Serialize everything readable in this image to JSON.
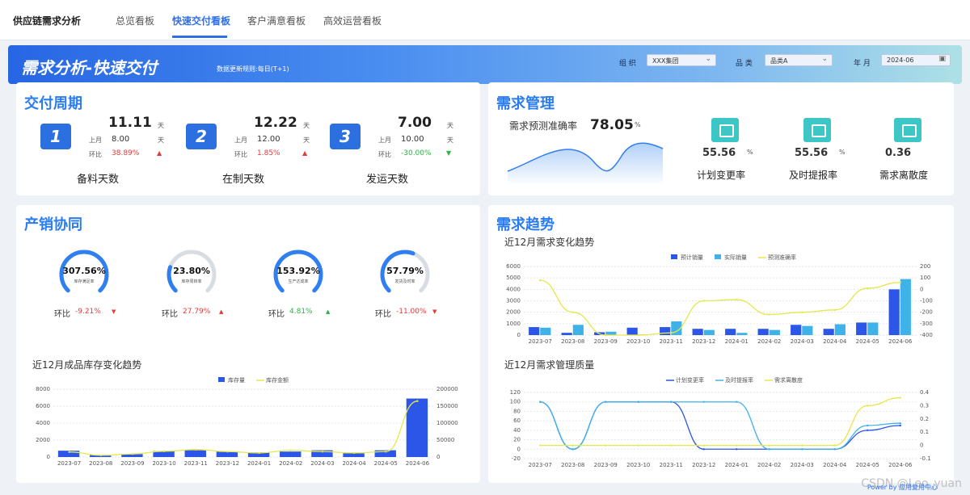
{
  "app": {
    "title": "供应链需求分析",
    "tabs": [
      "总览看板",
      "快速交付看板",
      "客户满意看板",
      "高效运营看板"
    ],
    "active_tab": 1
  },
  "banner": {
    "title": "需求分析-快速交付",
    "subtitle": "数据更新规则:每日(T+1)",
    "filters": [
      {
        "label": "组 织",
        "value": "XXX集团"
      },
      {
        "label": "品 类",
        "value": "品类A"
      },
      {
        "label": "年 月",
        "value": "2024-06"
      }
    ]
  },
  "delivery": {
    "title": "交付周期",
    "items": [
      {
        "num": "1",
        "value": "11.11",
        "unit": "天",
        "prev_label": "上月",
        "prev": "8.00",
        "prev_unit": "天",
        "chg_label": "环比",
        "chg": "38.89%",
        "dir": "up",
        "name": "备料天数"
      },
      {
        "num": "2",
        "value": "12.22",
        "unit": "天",
        "prev_label": "上月",
        "prev": "12.00",
        "prev_unit": "天",
        "chg_label": "环比",
        "chg": "1.85%",
        "dir": "up",
        "name": "在制天数"
      },
      {
        "num": "3",
        "value": "7.00",
        "unit": "天",
        "prev_label": "上月",
        "prev": "10.00",
        "prev_unit": "天",
        "chg_label": "环比",
        "chg": "-30.00%",
        "dir": "down",
        "name": "发运天数"
      }
    ]
  },
  "demand_mgmt": {
    "title": "需求管理",
    "acc_label": "需求预测准确率",
    "acc_value": "78.05",
    "acc_unit": "%",
    "metrics": [
      {
        "value": "55.56",
        "unit": "%",
        "name": "计划变更率",
        "icon": "document-icon"
      },
      {
        "value": "55.56",
        "unit": "%",
        "name": "及时提报率",
        "icon": "upload-icon"
      },
      {
        "value": "0.36",
        "unit": "",
        "name": "需求离散度",
        "icon": "scatter-icon"
      }
    ]
  },
  "prod_sales": {
    "title": "产销协同",
    "gauges": [
      {
        "value": "307.56%",
        "label": "库存满足率",
        "pct": 1.0,
        "color": "#2f7ff0",
        "chg_label": "环比",
        "chg": "-9.21%",
        "dir": "down"
      },
      {
        "value": "23.80%",
        "label": "库存周转率",
        "pct": 0.238,
        "color": "#2f7ff0",
        "chg_label": "环比",
        "chg": "27.79%",
        "dir": "up"
      },
      {
        "value": "153.92%",
        "label": "生产达成率",
        "pct": 1.0,
        "color": "#2f7ff0",
        "chg_label": "环比",
        "chg": "4.81%",
        "dir": "up"
      },
      {
        "value": "57.79%",
        "label": "发货及时率",
        "pct": 0.578,
        "color": "#2f7ff0",
        "chg_label": "环比",
        "chg": "-11.00%",
        "dir": "down"
      }
    ]
  },
  "trend": {
    "title": "需求趋势"
  },
  "colors": {
    "accent": "#2f6fe8",
    "bar1": "#2b56e8",
    "bar2": "#3fb2ea",
    "line_y": "#e4e84a"
  },
  "chart_data": [
    {
      "id": "inventory",
      "type": "bar",
      "title": "近12月成品库存变化趋势",
      "categories": [
        "2023-07",
        "2023-08",
        "2023-09",
        "2023-10",
        "2023-11",
        "2023-12",
        "2024-01",
        "2024-02",
        "2024-03",
        "2024-04",
        "2024-05",
        "2024-06"
      ],
      "series": [
        {
          "name": "库存量",
          "values": [
            750,
            250,
            350,
            700,
            800,
            650,
            550,
            650,
            800,
            450,
            800,
            6900
          ]
        },
        {
          "name": "库存金额",
          "values": [
            15000,
            5000,
            9000,
            17000,
            22000,
            16000,
            12000,
            20000,
            16000,
            12000,
            16000,
            165000
          ]
        }
      ],
      "ylim": [
        0,
        8000
      ],
      "y2lim": [
        0,
        200000
      ],
      "yticks": [
        0,
        2000,
        4000,
        6000,
        8000
      ],
      "y2ticks": [
        0,
        50000,
        100000,
        150000,
        200000
      ]
    },
    {
      "id": "demand_trend",
      "type": "bar",
      "title": "近12月需求变化趋势",
      "categories": [
        "2023-07",
        "2023-08",
        "2023-09",
        "2023-10",
        "2023-11",
        "2023-12",
        "2024-01",
        "2024-02",
        "2024-03",
        "2024-04",
        "2024-05",
        "2024-06"
      ],
      "series": [
        {
          "name": "预计销量",
          "values": [
            700,
            200,
            250,
            650,
            700,
            550,
            550,
            550,
            900,
            550,
            1100,
            4000
          ]
        },
        {
          "name": "实际销量",
          "values": [
            650,
            900,
            300,
            50,
            1200,
            450,
            200,
            450,
            800,
            950,
            1100,
            4900
          ]
        },
        {
          "name": "预测准确率",
          "values": [
            80,
            -200,
            -400,
            -400,
            -380,
            -100,
            -90,
            -220,
            -200,
            -180,
            10,
            60
          ]
        }
      ],
      "ylim": [
        0,
        6000
      ],
      "y2lim": [
        -400,
        200
      ],
      "yticks": [
        0,
        1000,
        2000,
        3000,
        4000,
        5000,
        6000
      ],
      "y2ticks": [
        -400,
        -300,
        -200,
        -100,
        0,
        100,
        200
      ]
    },
    {
      "id": "demand_quality",
      "type": "line",
      "title": "近12月需求管理质量",
      "categories": [
        "2023-07",
        "2023-08",
        "2023-09",
        "2023-10",
        "2023-11",
        "2023-12",
        "2024-01",
        "2024-02",
        "2024-03",
        "2024-04",
        "2024-05",
        "2024-06"
      ],
      "series": [
        {
          "name": "计划变更率",
          "values": [
            100,
            0,
            100,
            100,
            100,
            0,
            0,
            0,
            0,
            0,
            40,
            50
          ]
        },
        {
          "name": "及时提报率",
          "values": [
            100,
            0,
            100,
            100,
            100,
            100,
            100,
            0,
            0,
            0,
            50,
            55
          ]
        },
        {
          "name": "需求离散度",
          "values": [
            0,
            0,
            0,
            0,
            0,
            0,
            0,
            0,
            0,
            0,
            0.3,
            0.36
          ]
        }
      ],
      "ylim": [
        -20,
        120
      ],
      "y2lim": [
        -0.1,
        0.4
      ],
      "yticks": [
        -20,
        0,
        20,
        40,
        60,
        80,
        100,
        120
      ],
      "y2ticks": [
        -0.1,
        0,
        0.1,
        0.2,
        0.3,
        0.4
      ]
    }
  ],
  "footer": {
    "watermark": "CSDN @Leo_yuan",
    "power": "Power by 应用复用中心"
  }
}
